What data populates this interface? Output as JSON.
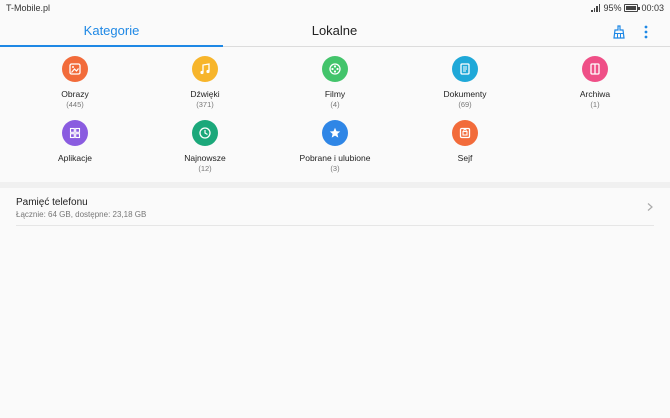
{
  "status": {
    "carrier": "T-Mobile.pl",
    "battery": "95%",
    "time": "00:03",
    "battery_level": 0.95
  },
  "tabs": [
    {
      "label": "Kategorie",
      "active": true
    },
    {
      "label": "Lokalne",
      "active": false
    }
  ],
  "toolbar": {
    "clean_icon": "broom-icon",
    "more_icon": "more-vert-icon"
  },
  "categories": [
    {
      "label": "Obrazy",
      "count": "(445)",
      "color": "#f26b3a",
      "icon": "image-icon"
    },
    {
      "label": "Dźwięki",
      "count": "(371)",
      "color": "#f7b52b",
      "icon": "music-icon"
    },
    {
      "label": "Filmy",
      "count": "(4)",
      "color": "#43c46b",
      "icon": "film-reel-icon"
    },
    {
      "label": "Dokumenty",
      "count": "(69)",
      "color": "#1fa8d8",
      "icon": "document-icon"
    },
    {
      "label": "Archiwa",
      "count": "(1)",
      "color": "#ef4f87",
      "icon": "archive-icon"
    },
    {
      "label": "Aplikacje",
      "count": "",
      "color": "#8a5ce0",
      "icon": "apps-icon"
    },
    {
      "label": "Najnowsze",
      "count": "(12)",
      "color": "#1ba87a",
      "icon": "clock-icon"
    },
    {
      "label": "Pobrane i ulubione",
      "count": "(3)",
      "color": "#2f86e6",
      "icon": "star-icon"
    },
    {
      "label": "Sejf",
      "count": "",
      "color": "#f26b3a",
      "icon": "safe-icon"
    }
  ],
  "storage": {
    "title": "Pamięć telefonu",
    "subtitle": "Łącznie: 64 GB, dostępne: 23,18 GB"
  }
}
